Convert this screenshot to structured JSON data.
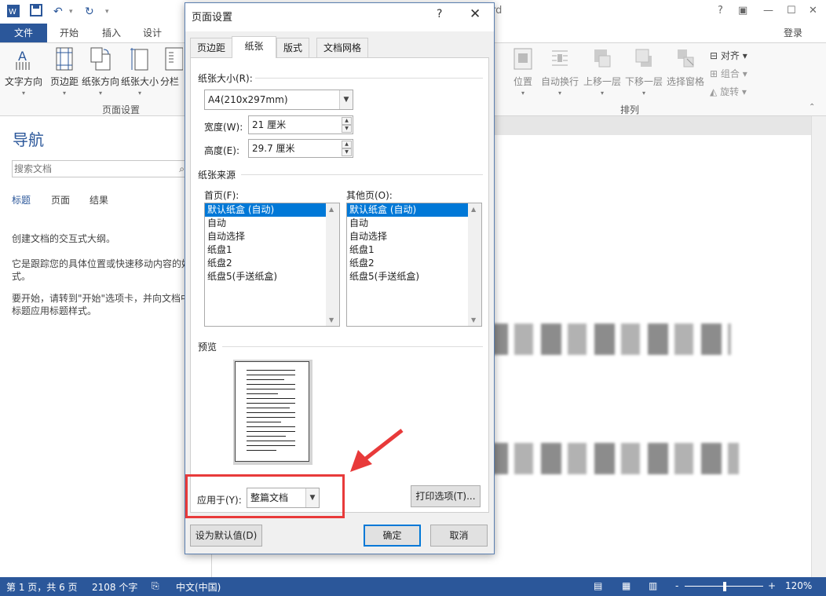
{
  "word": {
    "title_fragment": "ord",
    "login": "登录",
    "tabs": [
      "文件",
      "开始",
      "插入",
      "设计"
    ],
    "ribbon_left": [
      "文字方向",
      "页边距",
      "纸张方向",
      "纸张大小",
      "分栏"
    ],
    "group_page_setup": "页面设置",
    "ribbon_right": [
      "位置",
      "自动换行",
      "上移一层",
      "下移一层",
      "选择窗格"
    ],
    "small_items": [
      "对齐",
      "组合",
      "旋转"
    ],
    "group_arrange": "排列",
    "help_glyph": "?",
    "win_controls": [
      "?",
      "▣",
      "—",
      "☐",
      "✕"
    ]
  },
  "nav": {
    "title": "导航",
    "search_placeholder": "搜索文档",
    "tabs": [
      "标题",
      "页面",
      "结果"
    ],
    "line1": "创建文档的交互式大纲。",
    "line2a": "它是跟踪您的具体位置或快速移动内容的好",
    "line2b": "式。",
    "line3a": "要开始，请转到\"开始\"选项卡，并向文档中",
    "line3b": "标题应用标题样式。"
  },
  "status": {
    "page": "第 1 页，共 6 页",
    "words": "2108 个字",
    "lang": "中文(中国)",
    "zoom": "120%",
    "zoom_minus": "-",
    "zoom_plus": "+"
  },
  "dialog": {
    "title": "页面设置",
    "help": "?",
    "close": "✕",
    "tabs": [
      "页边距",
      "纸张",
      "版式",
      "文档网格"
    ],
    "paper_size_label": "纸张大小(R):",
    "paper_size_value": "A4(210x297mm)",
    "width_label": "宽度(W):",
    "width_value": "21 厘米",
    "height_label": "高度(E):",
    "height_value": "29.7 厘米",
    "paper_source_label": "纸张来源",
    "first_page_label": "首页(F):",
    "other_pages_label": "其他页(O):",
    "first_page_items": [
      "默认纸盒 (自动)",
      "自动",
      "自动选择",
      "纸盘1",
      "纸盘2",
      "纸盘5(手送纸盒)"
    ],
    "other_pages_items": [
      "默认纸盒 (自动)",
      "自动",
      "自动选择",
      "纸盘1",
      "纸盘2",
      "纸盘5(手送纸盒)"
    ],
    "preview_label": "预览",
    "apply_label": "应用于(Y):",
    "apply_value": "整篇文档",
    "print_options": "打印选项(T)...",
    "set_default": "设为默认值(D)",
    "ok": "确定",
    "cancel": "取消"
  },
  "colors": {
    "accent": "#2b579a",
    "highlight": "#e83a3a",
    "selection": "#0078d7"
  }
}
